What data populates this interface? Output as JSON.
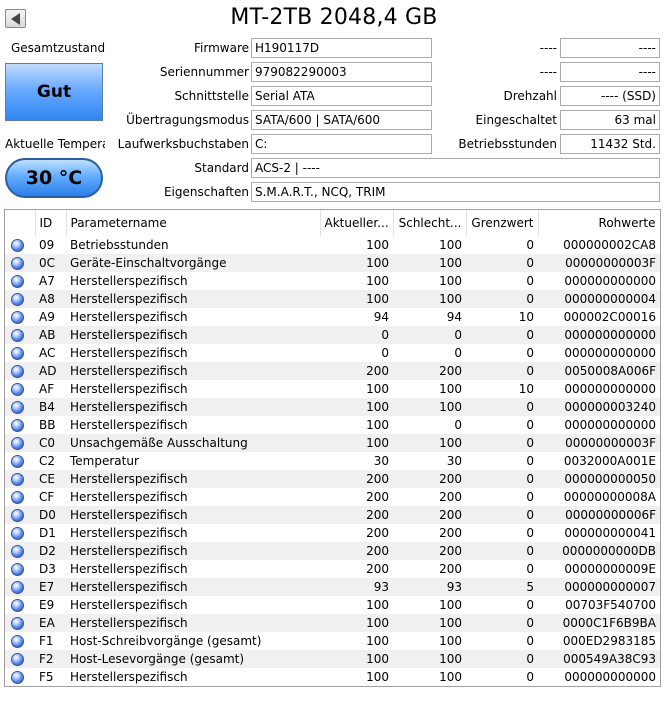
{
  "title": "MT-2TB 2048,4 GB",
  "left": {
    "health_label": "Gesamtzustand",
    "health_value": "Gut",
    "temp_label": "Aktuelle Temperat",
    "temp_value": "30 °C"
  },
  "fields": {
    "firmware": {
      "label": "Firmware",
      "value": "H190117D"
    },
    "serial": {
      "label": "Seriennummer",
      "value": "979082290003"
    },
    "interface": {
      "label": "Schnittstelle",
      "value": "Serial ATA"
    },
    "transfer": {
      "label": "Übertragungsmodus",
      "value": "SATA/600 | SATA/600"
    },
    "drive_letters": {
      "label": "Laufwerksbuchstaben",
      "value": "C:"
    },
    "standard": {
      "label": "Standard",
      "value": "ACS-2 | ----"
    },
    "features": {
      "label": "Eigenschaften",
      "value": "S.M.A.R.T., NCQ, TRIM"
    }
  },
  "right_fields": {
    "r1": {
      "label": "----",
      "value": "----"
    },
    "r2": {
      "label": "----",
      "value": "----"
    },
    "rotation": {
      "label": "Drehzahl",
      "value": "---- (SSD)"
    },
    "power_on_count": {
      "label": "Eingeschaltet",
      "value": "63 mal"
    },
    "power_on_hours": {
      "label": "Betriebsstunden",
      "value": "11432 Std."
    }
  },
  "table": {
    "headers": {
      "id": "ID",
      "name": "Parametername",
      "current": "Aktueller...",
      "worst": "Schlecht...",
      "threshold": "Grenzwert",
      "raw": "Rohwerte"
    },
    "rows": [
      {
        "id": "09",
        "name": "Betriebsstunden",
        "current": "100",
        "worst": "100",
        "threshold": "0",
        "raw": "000000002CA8"
      },
      {
        "id": "0C",
        "name": "Geräte-Einschaltvorgänge",
        "current": "100",
        "worst": "100",
        "threshold": "0",
        "raw": "00000000003F"
      },
      {
        "id": "A7",
        "name": "Herstellerspezifisch",
        "current": "100",
        "worst": "100",
        "threshold": "0",
        "raw": "000000000000"
      },
      {
        "id": "A8",
        "name": "Herstellerspezifisch",
        "current": "100",
        "worst": "100",
        "threshold": "0",
        "raw": "000000000004"
      },
      {
        "id": "A9",
        "name": "Herstellerspezifisch",
        "current": "94",
        "worst": "94",
        "threshold": "10",
        "raw": "000002C00016"
      },
      {
        "id": "AB",
        "name": "Herstellerspezifisch",
        "current": "0",
        "worst": "0",
        "threshold": "0",
        "raw": "000000000000"
      },
      {
        "id": "AC",
        "name": "Herstellerspezifisch",
        "current": "0",
        "worst": "0",
        "threshold": "0",
        "raw": "000000000000"
      },
      {
        "id": "AD",
        "name": "Herstellerspezifisch",
        "current": "200",
        "worst": "200",
        "threshold": "0",
        "raw": "0050008A006F"
      },
      {
        "id": "AF",
        "name": "Herstellerspezifisch",
        "current": "100",
        "worst": "100",
        "threshold": "10",
        "raw": "000000000000"
      },
      {
        "id": "B4",
        "name": "Herstellerspezifisch",
        "current": "100",
        "worst": "100",
        "threshold": "0",
        "raw": "000000003240"
      },
      {
        "id": "BB",
        "name": "Herstellerspezifisch",
        "current": "100",
        "worst": "0",
        "threshold": "0",
        "raw": "000000000000"
      },
      {
        "id": "C0",
        "name": "Unsachgemäße Ausschaltung",
        "current": "100",
        "worst": "100",
        "threshold": "0",
        "raw": "00000000003F"
      },
      {
        "id": "C2",
        "name": "Temperatur",
        "current": "30",
        "worst": "30",
        "threshold": "0",
        "raw": "0032000A001E"
      },
      {
        "id": "CE",
        "name": "Herstellerspezifisch",
        "current": "200",
        "worst": "200",
        "threshold": "0",
        "raw": "000000000050"
      },
      {
        "id": "CF",
        "name": "Herstellerspezifisch",
        "current": "200",
        "worst": "200",
        "threshold": "0",
        "raw": "00000000008A"
      },
      {
        "id": "D0",
        "name": "Herstellerspezifisch",
        "current": "200",
        "worst": "200",
        "threshold": "0",
        "raw": "00000000006F"
      },
      {
        "id": "D1",
        "name": "Herstellerspezifisch",
        "current": "200",
        "worst": "200",
        "threshold": "0",
        "raw": "000000000041"
      },
      {
        "id": "D2",
        "name": "Herstellerspezifisch",
        "current": "200",
        "worst": "200",
        "threshold": "0",
        "raw": "0000000000DB"
      },
      {
        "id": "D3",
        "name": "Herstellerspezifisch",
        "current": "200",
        "worst": "200",
        "threshold": "0",
        "raw": "00000000009E"
      },
      {
        "id": "E7",
        "name": "Herstellerspezifisch",
        "current": "93",
        "worst": "93",
        "threshold": "5",
        "raw": "000000000007"
      },
      {
        "id": "E9",
        "name": "Herstellerspezifisch",
        "current": "100",
        "worst": "100",
        "threshold": "0",
        "raw": "00703F540700"
      },
      {
        "id": "EA",
        "name": "Herstellerspezifisch",
        "current": "100",
        "worst": "100",
        "threshold": "0",
        "raw": "0000C1F6B9BA"
      },
      {
        "id": "F1",
        "name": "Host-Schreibvorgänge (gesamt)",
        "current": "100",
        "worst": "100",
        "threshold": "0",
        "raw": "000ED2983185"
      },
      {
        "id": "F2",
        "name": "Host-Lesevorgänge (gesamt)",
        "current": "100",
        "worst": "100",
        "threshold": "0",
        "raw": "000549A38C93"
      },
      {
        "id": "F5",
        "name": "Herstellerspezifisch",
        "current": "100",
        "worst": "100",
        "threshold": "0",
        "raw": "000000000000"
      }
    ]
  },
  "colors": {
    "health_blue": "#3a8df2",
    "dot_blue": "#5b86ea"
  }
}
